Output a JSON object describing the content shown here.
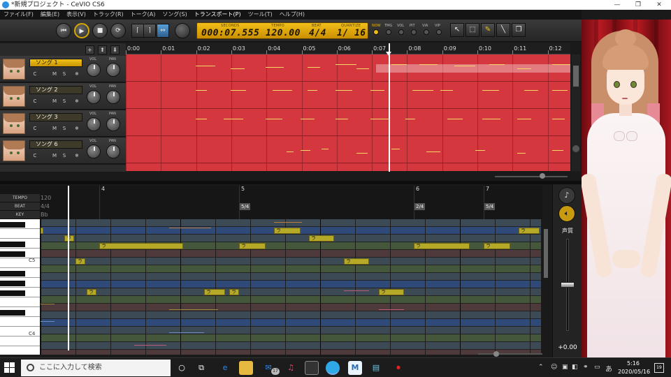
{
  "window": {
    "title": "*新規プロジェクト - CeVIO CS6",
    "controls": [
      "—",
      "❐",
      "✕"
    ]
  },
  "menu": [
    "ファイル(F)",
    "編集(E)",
    "表示(V)",
    "トラック(R)",
    "トーク(A)",
    "ソング(S)",
    "トランスポート(P)",
    "ツール(T)",
    "ヘルプ(H)"
  ],
  "transport": {
    "rewind": "⏮",
    "play": "▶",
    "stop": "■",
    "loop": "⟳",
    "seconds_label": "SECONDS",
    "seconds": "000:07.555",
    "tempo_label": "TEMPO",
    "tempo": "120.00",
    "beat_label": "BEAT",
    "beat": "4/4",
    "quantize_label": "QUANTIZE",
    "quantize": "1/ 16",
    "mini_labels": [
      "NOW",
      "TMG",
      "VOL",
      "PIT",
      "VIA",
      "VIP"
    ]
  },
  "track_header": {
    "add": "+",
    "up": "⬆",
    "down": "⬇"
  },
  "time_ruler": [
    "0:00",
    "0:01",
    "0:02",
    "0:03",
    "0:04",
    "0:05",
    "0:06",
    "0:07",
    "0:08",
    "0:09",
    "0:10",
    "0:11",
    "0:12"
  ],
  "tracks": [
    {
      "name": "ソング 1",
      "c": "C",
      "m": "M",
      "s": "S",
      "fx": "❄",
      "vol": "VOL",
      "pan": "PAN"
    },
    {
      "name": "ソング 2",
      "c": "C",
      "m": "M",
      "s": "S",
      "fx": "❄",
      "vol": "VOL",
      "pan": "PAN"
    },
    {
      "name": "ソング 3",
      "c": "C",
      "m": "M",
      "s": "S",
      "fx": "❄",
      "vol": "VOL",
      "pan": "PAN"
    },
    {
      "name": "ソング 6",
      "c": "C",
      "m": "M",
      "s": "S",
      "fx": "❄",
      "vol": "VOL",
      "pan": "PAN"
    }
  ],
  "piano_roll": {
    "row_labels": {
      "tempo": "TEMPO",
      "beat": "BEAT",
      "key": "KEY"
    },
    "tempo_value": "120",
    "beat_value": "4/4",
    "key_value": "Bb",
    "bars": [
      "4",
      "5",
      "6",
      "7"
    ],
    "beat_badges": [
      "5/4",
      "2/4",
      "5/4"
    ],
    "key_labels": [
      "C5",
      "C4"
    ],
    "note_lyric": "ラ"
  },
  "right_panel": {
    "voice_label": "声質",
    "fader_value": "+0.00",
    "fader_fraction": 0.5
  },
  "taskbar": {
    "search_placeholder": "ここに入力して検索",
    "time": "5:16",
    "date": "2020/05/16",
    "ime": "あ",
    "notifications": "19",
    "mail_badge": "17"
  },
  "colors": {
    "transport_display": "#f0b90f",
    "song_area": "#d4373d",
    "note": "#b6a928",
    "selected_track": "#f0c21a"
  }
}
